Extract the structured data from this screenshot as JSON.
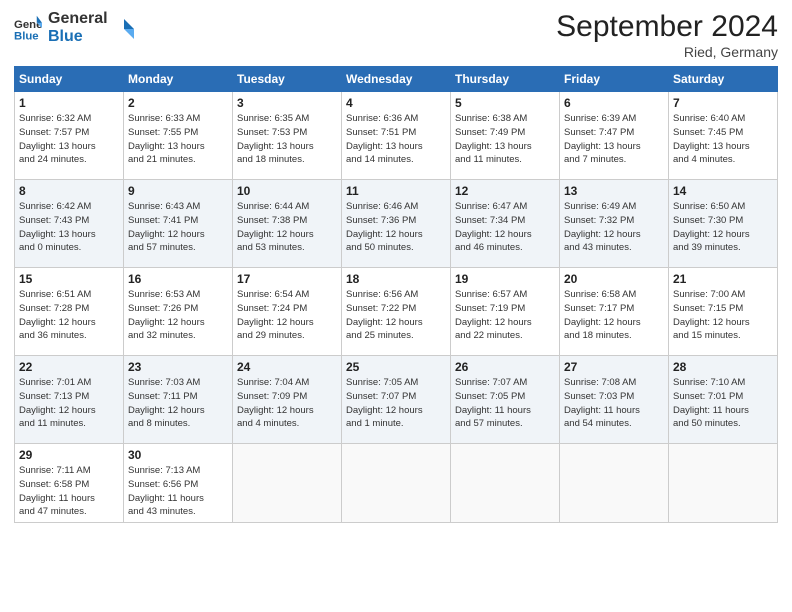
{
  "header": {
    "logo_line1": "General",
    "logo_line2": "Blue",
    "month": "September 2024",
    "location": "Ried, Germany"
  },
  "days_of_week": [
    "Sunday",
    "Monday",
    "Tuesday",
    "Wednesday",
    "Thursday",
    "Friday",
    "Saturday"
  ],
  "weeks": [
    [
      {
        "day": "1",
        "info": "Sunrise: 6:32 AM\nSunset: 7:57 PM\nDaylight: 13 hours\nand 24 minutes."
      },
      {
        "day": "2",
        "info": "Sunrise: 6:33 AM\nSunset: 7:55 PM\nDaylight: 13 hours\nand 21 minutes."
      },
      {
        "day": "3",
        "info": "Sunrise: 6:35 AM\nSunset: 7:53 PM\nDaylight: 13 hours\nand 18 minutes."
      },
      {
        "day": "4",
        "info": "Sunrise: 6:36 AM\nSunset: 7:51 PM\nDaylight: 13 hours\nand 14 minutes."
      },
      {
        "day": "5",
        "info": "Sunrise: 6:38 AM\nSunset: 7:49 PM\nDaylight: 13 hours\nand 11 minutes."
      },
      {
        "day": "6",
        "info": "Sunrise: 6:39 AM\nSunset: 7:47 PM\nDaylight: 13 hours\nand 7 minutes."
      },
      {
        "day": "7",
        "info": "Sunrise: 6:40 AM\nSunset: 7:45 PM\nDaylight: 13 hours\nand 4 minutes."
      }
    ],
    [
      {
        "day": "8",
        "info": "Sunrise: 6:42 AM\nSunset: 7:43 PM\nDaylight: 13 hours\nand 0 minutes."
      },
      {
        "day": "9",
        "info": "Sunrise: 6:43 AM\nSunset: 7:41 PM\nDaylight: 12 hours\nand 57 minutes."
      },
      {
        "day": "10",
        "info": "Sunrise: 6:44 AM\nSunset: 7:38 PM\nDaylight: 12 hours\nand 53 minutes."
      },
      {
        "day": "11",
        "info": "Sunrise: 6:46 AM\nSunset: 7:36 PM\nDaylight: 12 hours\nand 50 minutes."
      },
      {
        "day": "12",
        "info": "Sunrise: 6:47 AM\nSunset: 7:34 PM\nDaylight: 12 hours\nand 46 minutes."
      },
      {
        "day": "13",
        "info": "Sunrise: 6:49 AM\nSunset: 7:32 PM\nDaylight: 12 hours\nand 43 minutes."
      },
      {
        "day": "14",
        "info": "Sunrise: 6:50 AM\nSunset: 7:30 PM\nDaylight: 12 hours\nand 39 minutes."
      }
    ],
    [
      {
        "day": "15",
        "info": "Sunrise: 6:51 AM\nSunset: 7:28 PM\nDaylight: 12 hours\nand 36 minutes."
      },
      {
        "day": "16",
        "info": "Sunrise: 6:53 AM\nSunset: 7:26 PM\nDaylight: 12 hours\nand 32 minutes."
      },
      {
        "day": "17",
        "info": "Sunrise: 6:54 AM\nSunset: 7:24 PM\nDaylight: 12 hours\nand 29 minutes."
      },
      {
        "day": "18",
        "info": "Sunrise: 6:56 AM\nSunset: 7:22 PM\nDaylight: 12 hours\nand 25 minutes."
      },
      {
        "day": "19",
        "info": "Sunrise: 6:57 AM\nSunset: 7:19 PM\nDaylight: 12 hours\nand 22 minutes."
      },
      {
        "day": "20",
        "info": "Sunrise: 6:58 AM\nSunset: 7:17 PM\nDaylight: 12 hours\nand 18 minutes."
      },
      {
        "day": "21",
        "info": "Sunrise: 7:00 AM\nSunset: 7:15 PM\nDaylight: 12 hours\nand 15 minutes."
      }
    ],
    [
      {
        "day": "22",
        "info": "Sunrise: 7:01 AM\nSunset: 7:13 PM\nDaylight: 12 hours\nand 11 minutes."
      },
      {
        "day": "23",
        "info": "Sunrise: 7:03 AM\nSunset: 7:11 PM\nDaylight: 12 hours\nand 8 minutes."
      },
      {
        "day": "24",
        "info": "Sunrise: 7:04 AM\nSunset: 7:09 PM\nDaylight: 12 hours\nand 4 minutes."
      },
      {
        "day": "25",
        "info": "Sunrise: 7:05 AM\nSunset: 7:07 PM\nDaylight: 12 hours\nand 1 minute."
      },
      {
        "day": "26",
        "info": "Sunrise: 7:07 AM\nSunset: 7:05 PM\nDaylight: 11 hours\nand 57 minutes."
      },
      {
        "day": "27",
        "info": "Sunrise: 7:08 AM\nSunset: 7:03 PM\nDaylight: 11 hours\nand 54 minutes."
      },
      {
        "day": "28",
        "info": "Sunrise: 7:10 AM\nSunset: 7:01 PM\nDaylight: 11 hours\nand 50 minutes."
      }
    ],
    [
      {
        "day": "29",
        "info": "Sunrise: 7:11 AM\nSunset: 6:58 PM\nDaylight: 11 hours\nand 47 minutes."
      },
      {
        "day": "30",
        "info": "Sunrise: 7:13 AM\nSunset: 6:56 PM\nDaylight: 11 hours\nand 43 minutes."
      },
      {
        "day": "",
        "info": ""
      },
      {
        "day": "",
        "info": ""
      },
      {
        "day": "",
        "info": ""
      },
      {
        "day": "",
        "info": ""
      },
      {
        "day": "",
        "info": ""
      }
    ]
  ]
}
